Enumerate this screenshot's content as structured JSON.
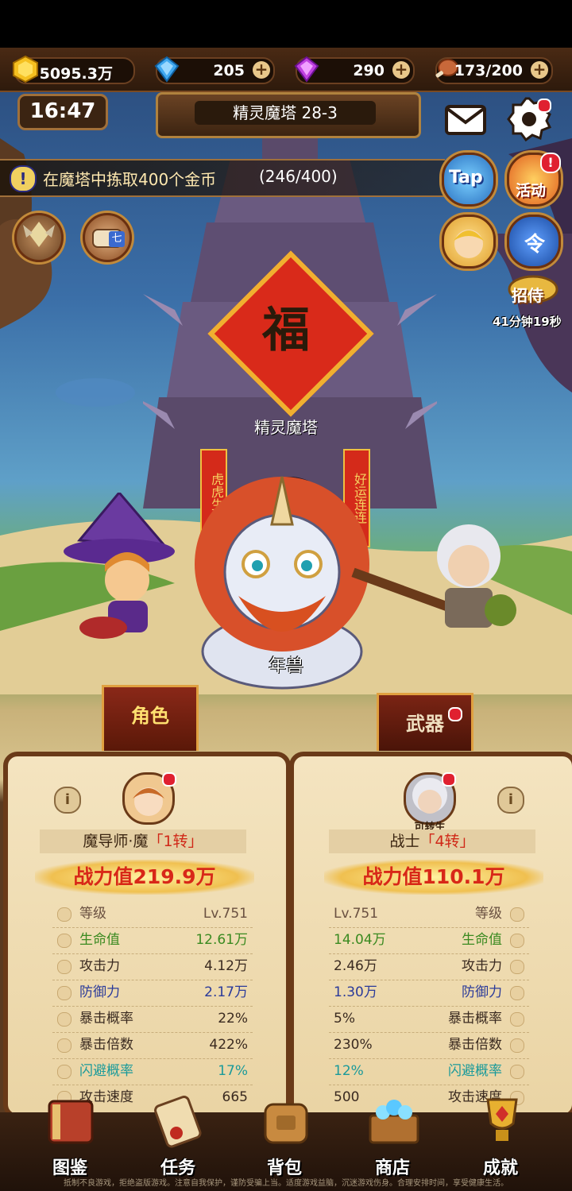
{
  "resources": {
    "gold": "5095.3万",
    "gems_blue": "205",
    "gems_purple": "290",
    "stamina": "173/200"
  },
  "hud": {
    "clock": "16:47",
    "stage_label": "精灵魔塔 28-3",
    "quest_text": "在魔塔中拣取400个金币",
    "quest_progress": "(246/400)",
    "tap_label": "Tap",
    "event_label": "活动",
    "side_button_label": "令",
    "recruit_label": "招侍",
    "recruit_timer": "41分钟19秒",
    "scroll_badge": "七"
  },
  "scene": {
    "tower_banner": "福",
    "tower_name": "精灵魔塔",
    "couplet_left": "虎虎生威",
    "couplet_right": "好运连连",
    "boss_name": "年兽"
  },
  "tabs": {
    "character": "角色",
    "weapon": "武器"
  },
  "left_page": {
    "info": "i",
    "name_prefix": "魔导师·魔",
    "rebirth": "「1转」",
    "power": "战力值219.9万",
    "stats": [
      {
        "label": "等级",
        "value": "Lv.751"
      },
      {
        "label": "生命值",
        "value": "12.61万"
      },
      {
        "label": "攻击力",
        "value": "4.12万"
      },
      {
        "label": "防御力",
        "value": "2.17万"
      },
      {
        "label": "暴击概率",
        "value": "22%"
      },
      {
        "label": "暴击倍数",
        "value": "422%"
      },
      {
        "label": "闪避概率",
        "value": "17%"
      },
      {
        "label": "攻击速度",
        "value": "665"
      }
    ]
  },
  "right_page": {
    "info": "i",
    "avatar_tag": "可转生",
    "name_prefix": "战士",
    "rebirth": "「4转」",
    "power": "战力值110.1万",
    "stats": [
      {
        "label": "等级",
        "value": "Lv.751"
      },
      {
        "label": "生命值",
        "value": "14.04万"
      },
      {
        "label": "攻击力",
        "value": "2.46万"
      },
      {
        "label": "防御力",
        "value": "1.30万"
      },
      {
        "label": "暴击概率",
        "value": "5%"
      },
      {
        "label": "暴击倍数",
        "value": "230%"
      },
      {
        "label": "闪避概率",
        "value": "12%"
      },
      {
        "label": "攻击速度",
        "value": "500"
      }
    ]
  },
  "nav": [
    {
      "label": "图鉴",
      "icon": "book-icon"
    },
    {
      "label": "任务",
      "icon": "scroll-icon"
    },
    {
      "label": "背包",
      "icon": "backpack-icon"
    },
    {
      "label": "商店",
      "icon": "treasure-chest-icon"
    },
    {
      "label": "成就",
      "icon": "trophy-icon"
    }
  ],
  "notice": "抵制不良游戏，拒绝盗版游戏。注意自我保护，谨防受骗上当。适度游戏益脑，沉迷游戏伤身。合理安排时间，享受健康生活。",
  "colors": {
    "accent_red": "#d82818",
    "parchment": "#f4e4c0",
    "wood_dark": "#3a2212"
  }
}
